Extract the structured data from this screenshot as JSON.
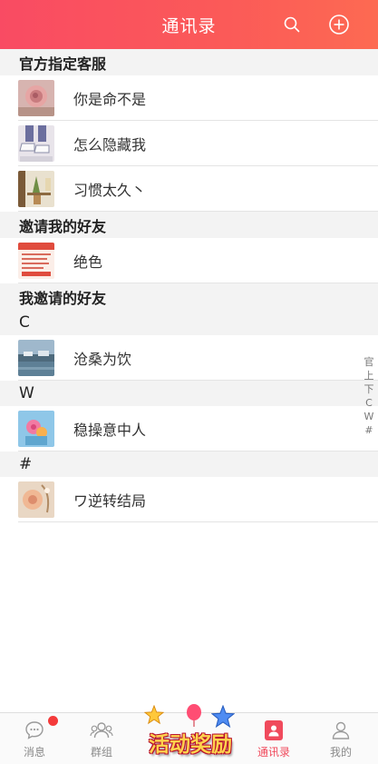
{
  "header": {
    "title": "通讯录"
  },
  "sections": [
    {
      "title": "官方指定客服",
      "contacts": [
        {
          "name": "你是命不是",
          "avatar_icon": "rose-photo"
        },
        {
          "name": "怎么隐藏我",
          "avatar_icon": "sneakers-photo"
        },
        {
          "name": "习惯太久丶",
          "avatar_icon": "plant-shelf-photo"
        }
      ]
    },
    {
      "title": "邀请我的好友",
      "contacts": [
        {
          "name": "绝色",
          "avatar_icon": "document-poster"
        }
      ]
    },
    {
      "title": "我邀请的好友",
      "contacts": []
    },
    {
      "title": "C",
      "contacts": [
        {
          "name": "沧桑为饮",
          "avatar_icon": "landscape-photo"
        }
      ]
    },
    {
      "title": "W",
      "contacts": [
        {
          "name": "稳操意中人",
          "avatar_icon": "pink-flower-photo"
        }
      ]
    },
    {
      "title": "#",
      "contacts": [
        {
          "name": "ワ逆转结局",
          "avatar_icon": "peach-flower-photo"
        }
      ]
    }
  ],
  "index_bar": [
    "官",
    "上",
    "下",
    "C",
    "W",
    "#"
  ],
  "tabbar": {
    "messages": "消息",
    "groups": "群组",
    "promo": "活动奖励",
    "contacts": "通讯录",
    "mine": "我的"
  },
  "colors": {
    "accent": "#f94b63",
    "header_end": "#fd6a52",
    "badge": "#f43a3a"
  }
}
